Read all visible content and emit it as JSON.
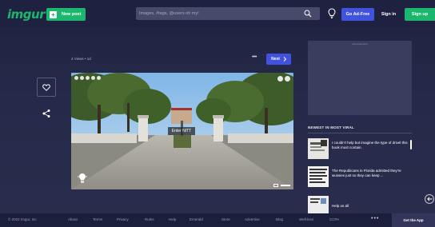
{
  "header": {
    "logo": "imgur",
    "new_post_label": "New post",
    "search_placeholder": "Images, #tags, @users oh my!",
    "go_adfree_label": "Go Ad-Free",
    "sign_in_label": "Sign in",
    "sign_up_label": "Sign up"
  },
  "post": {
    "meta": "4 Views • 1d",
    "more_label": "•••",
    "next_label": "Next",
    "sign_text": "Enter NITT"
  },
  "sidebar": {
    "ad_label": "Advertisement",
    "heading": "NEWEST IN MOST VIRAL",
    "items": [
      {
        "text": "I couldn't help but imagine the type of drivel this book must contain."
      },
      {
        "text": "The Republicans in Florida admitted they're wussies just so they can keep ..."
      },
      {
        "text": "Help us all"
      }
    ]
  },
  "footer": {
    "copyright": "© 2022 Imgur, Inc",
    "links": [
      "About",
      "Terms",
      "Privacy",
      "Rules",
      "Help",
      "Emerald",
      "Store",
      "Advertise",
      "Blog",
      "Well-less",
      "CCPA"
    ],
    "more": "•••",
    "get_app": "Get the App"
  },
  "colors": {
    "brand_green": "#1bb76e",
    "accent_blue": "#4152de",
    "background": "#262a4a"
  }
}
